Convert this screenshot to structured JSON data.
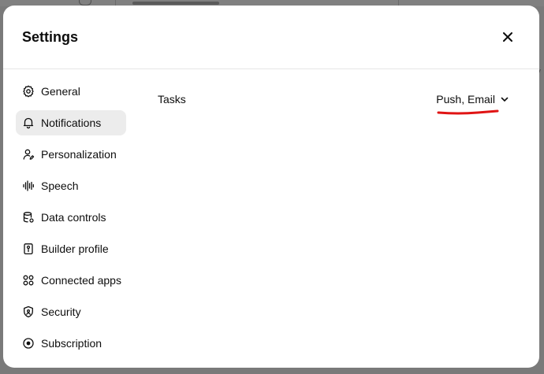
{
  "dialog": {
    "title": "Settings",
    "close_label": "Close"
  },
  "sidebar": {
    "items": [
      {
        "label": "General",
        "icon": "gear-icon",
        "active": false
      },
      {
        "label": "Notifications",
        "icon": "bell-icon",
        "active": true
      },
      {
        "label": "Personalization",
        "icon": "person-icon",
        "active": false
      },
      {
        "label": "Speech",
        "icon": "waveform-icon",
        "active": false
      },
      {
        "label": "Data controls",
        "icon": "database-icon",
        "active": false
      },
      {
        "label": "Builder profile",
        "icon": "id-card-icon",
        "active": false
      },
      {
        "label": "Connected apps",
        "icon": "apps-grid-icon",
        "active": false
      },
      {
        "label": "Security",
        "icon": "shield-icon",
        "active": false
      },
      {
        "label": "Subscription",
        "icon": "subscription-icon",
        "active": false
      }
    ]
  },
  "notifications": {
    "settings": [
      {
        "label": "Tasks",
        "value": "Push, Email"
      }
    ]
  },
  "colors": {
    "annotation": "#e01414",
    "active_bg": "#ececec",
    "text": "#0d0d0d"
  }
}
